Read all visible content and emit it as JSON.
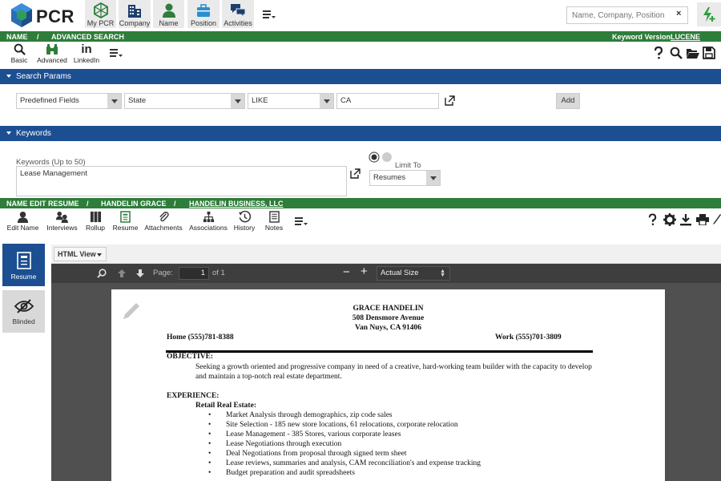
{
  "app": {
    "logo_text": "PCR"
  },
  "nav": {
    "items": [
      {
        "label": "My PCR",
        "icon": "cube-icon"
      },
      {
        "label": "Company",
        "icon": "building-icon"
      },
      {
        "label": "Name",
        "icon": "person-icon"
      },
      {
        "label": "Position",
        "icon": "briefcase-icon"
      },
      {
        "label": "Activities",
        "icon": "chat-icon"
      }
    ],
    "search_placeholder": "Name, Company, Position",
    "clear": "×"
  },
  "breadcrumb1": {
    "part1": "NAME",
    "sep": "/",
    "part2": "ADVANCED SEARCH",
    "keyword_label": "Keyword Version:",
    "keyword_value": "LUCENE"
  },
  "search_toolbar": {
    "basic": "Basic",
    "advanced": "Advanced",
    "linkedin": "LinkedIn",
    "linkedin_glyph": "in"
  },
  "search_params": {
    "title": "Search Params",
    "field_type": "Predefined Fields",
    "field": "State",
    "operator": "LIKE",
    "value": "CA",
    "add": "Add"
  },
  "keywords": {
    "title": "Keywords",
    "label": "Keywords (Up to 50)",
    "value": "Lease Management",
    "limit_label": "Limit To",
    "limit_value": "Resumes"
  },
  "breadcrumb2": {
    "part1": "NAME EDIT RESUME",
    "sep": "/",
    "part2": "HANDELIN GRACE",
    "part3": "HANDELIN BUSINESS, LLC"
  },
  "record_toolbar": {
    "items": [
      "Edit Name",
      "Interviews",
      "Rollup",
      "Resume",
      "Attachments",
      "Associations",
      "History",
      "Notes"
    ]
  },
  "side": {
    "resume": "Resume",
    "blinded": "Blinded"
  },
  "viewer": {
    "view_mode": "HTML View",
    "page_label": "Page:",
    "page_number": "1",
    "page_of": "of 1",
    "zoom": "Actual Size",
    "minus": "−",
    "plus": "+"
  },
  "resume": {
    "name": "GRACE HANDELIN",
    "address1": "508 Densmore Avenue",
    "address2": "Van Nuys, CA  91406",
    "home": "Home  (555)781-8388",
    "work": "Work  (555)701-3809",
    "objective_heading": "OBJECTIVE:",
    "objective_line1": "Seeking a growth oriented and progressive company in need of a creative, hard-working team builder with the capacity to develop",
    "objective_line2": "and maintain a top-notch real estate department.",
    "experience_heading": "EXPERIENCE:",
    "subheading": "Retail Real Estate:",
    "bullets": [
      "Market Analysis through demographics, zip code sales",
      "Site Selection - 185 new store locations, 61 relocations, corporate relocation",
      "Lease Management - 385 Stores, various corporate leases",
      "Lease Negotiations through execution",
      "Deal Negotiations from proposal through signed term sheet",
      "Lease reviews, summaries and analysis, CAM reconciliation's and expense tracking",
      "Budget preparation and audit spreadsheets"
    ]
  }
}
